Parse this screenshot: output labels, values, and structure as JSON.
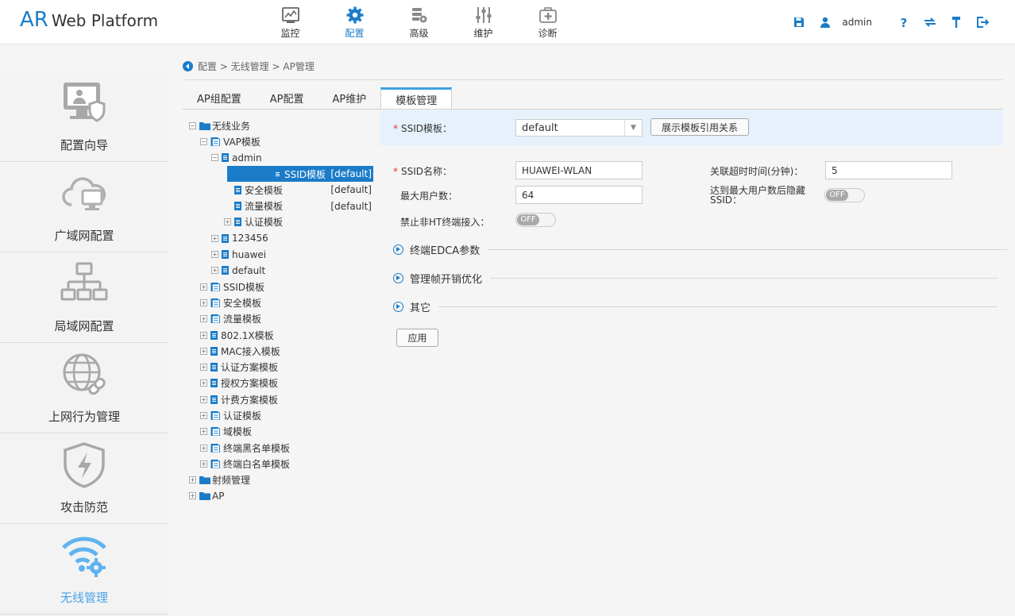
{
  "brand": {
    "ar": "AR",
    "rest": "Web Platform"
  },
  "topnav": [
    {
      "label": "监控",
      "icon": "monitor-chart-icon"
    },
    {
      "label": "配置",
      "icon": "gear-icon"
    },
    {
      "label": "高级",
      "icon": "advanced-gear-icon"
    },
    {
      "label": "维护",
      "icon": "sliders-icon"
    },
    {
      "label": "诊断",
      "icon": "medical-kit-icon"
    }
  ],
  "topright": {
    "user": "admin"
  },
  "sidebar": [
    {
      "label": "配置向导",
      "icon": "wizard-monitor-shield-icon"
    },
    {
      "label": "广域网配置",
      "icon": "cloud-monitor-icon"
    },
    {
      "label": "局域网配置",
      "icon": "lan-topology-icon"
    },
    {
      "label": "上网行为管理",
      "icon": "globe-link-icon"
    },
    {
      "label": "攻击防范",
      "icon": "shield-lightning-icon"
    },
    {
      "label": "无线管理",
      "icon": "wifi-gear-icon"
    }
  ],
  "breadcrumb": "配置 > 无线管理 > AP管理",
  "tabs": [
    "AP组配置",
    "AP配置",
    "AP维护",
    "模板管理"
  ],
  "tree": [
    {
      "label": "无线业务",
      "level": 0,
      "type": "folder",
      "exp": "−"
    },
    {
      "label": "VAP模板",
      "level": 1,
      "type": "folder-doc",
      "exp": "−"
    },
    {
      "label": "admin",
      "level": 2,
      "type": "doc",
      "exp": "−"
    },
    {
      "label": "SSID模板",
      "level": 3,
      "type": "doc",
      "exp": "",
      "tag": "[default]",
      "selected": true
    },
    {
      "label": "安全模板",
      "level": 3,
      "type": "doc",
      "exp": "",
      "tag": "[default]"
    },
    {
      "label": "流量模板",
      "level": 3,
      "type": "doc",
      "exp": "",
      "tag": "[default]"
    },
    {
      "label": "认证模板",
      "level": 3,
      "type": "doc",
      "exp": "+"
    },
    {
      "label": "123456",
      "level": 2,
      "type": "doc",
      "exp": "+"
    },
    {
      "label": "huawei",
      "level": 2,
      "type": "doc",
      "exp": "+"
    },
    {
      "label": "default",
      "level": 2,
      "type": "doc",
      "exp": "+"
    },
    {
      "label": "SSID模板",
      "level": 1,
      "type": "folder-doc",
      "exp": "+"
    },
    {
      "label": "安全模板",
      "level": 1,
      "type": "folder-doc",
      "exp": "+"
    },
    {
      "label": "流量模板",
      "level": 1,
      "type": "folder-doc",
      "exp": "+"
    },
    {
      "label": "802.1X模板",
      "level": 1,
      "type": "doc",
      "exp": "+"
    },
    {
      "label": "MAC接入模板",
      "level": 1,
      "type": "doc",
      "exp": "+"
    },
    {
      "label": "认证方案模板",
      "level": 1,
      "type": "doc",
      "exp": "+"
    },
    {
      "label": "授权方案模板",
      "level": 1,
      "type": "doc",
      "exp": "+"
    },
    {
      "label": "计费方案模板",
      "level": 1,
      "type": "doc",
      "exp": "+"
    },
    {
      "label": "认证模板",
      "level": 1,
      "type": "folder-doc",
      "exp": "+"
    },
    {
      "label": "域模板",
      "level": 1,
      "type": "folder-doc",
      "exp": "+"
    },
    {
      "label": "终端黑名单模板",
      "level": 1,
      "type": "folder-doc",
      "exp": "+"
    },
    {
      "label": "终端白名单模板",
      "level": 1,
      "type": "folder-doc",
      "exp": "+"
    },
    {
      "label": "射频管理",
      "level": 0,
      "type": "folder",
      "exp": "+"
    },
    {
      "label": "AP",
      "level": 0,
      "type": "folder",
      "exp": "+"
    }
  ],
  "form": {
    "ssid_profile_label": "SSID模板：",
    "ssid_profile_value": "default",
    "show_relation_btn": "展示模板引用关系",
    "ssid_name_label": "SSID名称：",
    "ssid_name_value": "HUAWEI-WLAN",
    "assoc_timeout_label": "关联超时时间(分钟)：",
    "assoc_timeout_value": "5",
    "max_users_label": "最大用户数：",
    "max_users_value": "64",
    "hide_ssid_label_1": "达到最大用户数后隐藏",
    "hide_ssid_label_2": "SSID：",
    "hide_ssid_toggle": "OFF",
    "deny_nonht_label": "禁止非HT终端接入：",
    "deny_nonht_toggle": "OFF",
    "sections": [
      "终端EDCA参数",
      "管理帧开销优化",
      "其它"
    ],
    "apply_btn": "应用"
  },
  "colors": {
    "accent": "#1a7cc9",
    "tab_active": "#3ba0e5",
    "selected_row": "#1a7cc9",
    "form_head_bg": "#e6f1fb"
  }
}
